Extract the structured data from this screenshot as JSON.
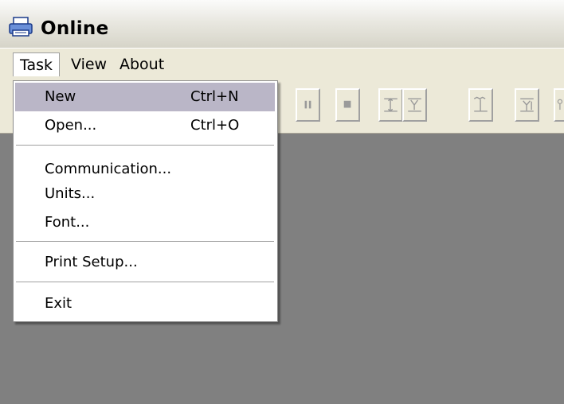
{
  "window": {
    "title": "Online",
    "icon": "printer-icon"
  },
  "menubar": {
    "items": [
      "Task",
      "View",
      "About"
    ],
    "active": "Task"
  },
  "toolbar": {
    "buttons": [
      {
        "icon": "pause-icon"
      },
      {
        "icon": "stop-icon"
      },
      {
        "icon": "x-range-icon"
      },
      {
        "icon": "y-range-icon"
      },
      {
        "icon": "x-range-alt-icon"
      },
      {
        "icon": "y-range-alt-icon"
      },
      {
        "icon": "misc-icon"
      }
    ]
  },
  "task_menu": {
    "new": {
      "label": "New",
      "shortcut": "Ctrl+N"
    },
    "open": {
      "label": "Open...",
      "shortcut": "Ctrl+O"
    },
    "communication": {
      "label": "Communication..."
    },
    "units": {
      "label": "Units..."
    },
    "font": {
      "label": "Font..."
    },
    "print_setup": {
      "label": "Print Setup..."
    },
    "exit": {
      "label": "Exit"
    },
    "selected": "New"
  },
  "colors": {
    "client_background": "#808080",
    "menu_highlight": "#bab6c7",
    "chrome": "#ece9d8"
  }
}
